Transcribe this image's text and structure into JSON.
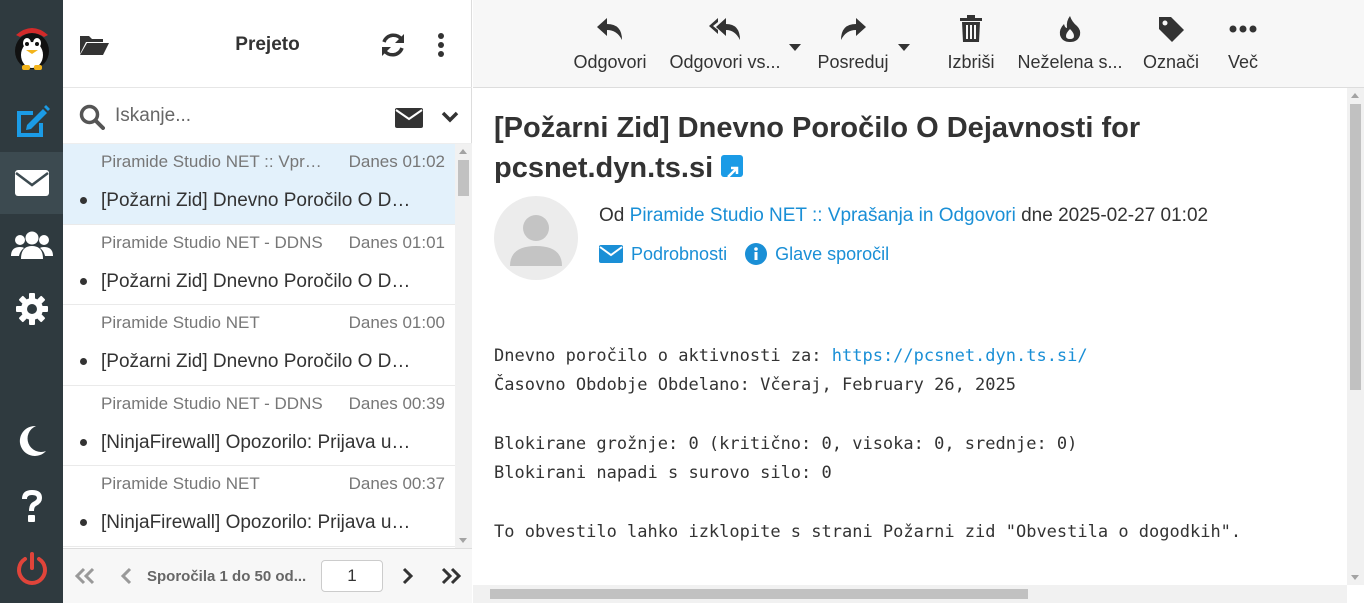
{
  "taskbar": {
    "items": [
      {
        "name": "compose",
        "icon": "compose-icon"
      },
      {
        "name": "mail",
        "icon": "envelope-icon",
        "active": true
      },
      {
        "name": "contacts",
        "icon": "contacts-icon"
      },
      {
        "name": "settings",
        "icon": "gear-icon"
      },
      {
        "name": "theme",
        "icon": "moon-icon"
      },
      {
        "name": "help",
        "icon": "help-icon"
      },
      {
        "name": "logout",
        "icon": "power-icon"
      }
    ],
    "colors": {
      "bg": "#2f3a3f",
      "accent": "#1b9be6",
      "logout": "#e0443a"
    }
  },
  "list": {
    "title": "Prejeto",
    "search_placeholder": "Iskanje...",
    "messages": [
      {
        "from": "Piramide Studio NET :: Vprašanja in Odgovori",
        "date": "Danes 01:02",
        "subject": "[Požarni Zid] Dnevno Poročilo O Dejavnosti for pcsnet.dyn.ts.si",
        "selected": true
      },
      {
        "from": "Piramide Studio NET - DDNS",
        "date": "Danes 01:01",
        "subject": "[Požarni Zid] Dnevno Poročilo O Dejavnosti",
        "selected": false
      },
      {
        "from": "Piramide Studio NET",
        "date": "Danes 01:00",
        "subject": "[Požarni Zid] Dnevno Poročilo O Dejavnosti",
        "selected": false
      },
      {
        "from": "Piramide Studio NET - DDNS",
        "date": "Danes 00:39",
        "subject": "[NinjaFirewall] Opozorilo: Prijava uporabnika",
        "selected": false
      },
      {
        "from": "Piramide Studio NET",
        "date": "Danes 00:37",
        "subject": "[NinjaFirewall] Opozorilo: Prijava uporabnika",
        "selected": false
      }
    ],
    "pager_text": "Sporočila 1 do 50 od...",
    "page_value": "1"
  },
  "toolbar": {
    "reply": "Odgovori",
    "reply_all": "Odgovori vs...",
    "forward": "Posreduj",
    "delete": "Izbriši",
    "junk": "Neželena s...",
    "tag": "Označi",
    "more": "Več"
  },
  "message": {
    "subject": "[Požarni Zid] Dnevno Poročilo O Dejavnosti for pcsnet.dyn.ts.si",
    "from_prefix": "Od",
    "from_name": "Piramide Studio NET :: Vprašanja in Odgovori",
    "date_text": "dne 2025-02-27 01:02",
    "details_link": "Podrobnosti",
    "headers_link": "Glave sporočil",
    "body": {
      "line1_text": "Dnevno poročilo o aktivnosti za: ",
      "line1_link": "https://pcsnet.dyn.ts.si/",
      "line2": "Časovno Obdobje Obdelano: Včeraj, February 26, 2025",
      "line3": "Blokirane grožnje: 0 (kritično: 0, visoka: 0, srednje: 0)",
      "line4": "Blokirani napadi s surovo silo: 0",
      "line5": "To obvestilo lahko izklopite s strani Požarni zid \"Obvestila o dogodkih\"."
    }
  }
}
